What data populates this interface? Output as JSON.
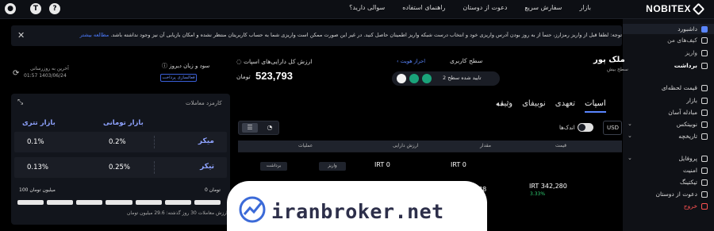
{
  "topbar": {
    "logo": "NOBITEX",
    "nav": [
      "بازار",
      "سفارش سریع",
      "دعوت از دوستان",
      "راهنمای استفاده",
      "سوالی دارید؟"
    ],
    "icons": [
      "user-icon",
      "shirt-icon",
      "help-icon"
    ]
  },
  "notice": {
    "text": "توجه: لطفا قبل از واریز رمزارز، حتماً از به روز بودن آدرس واریزی خود و انتخاب درست شبکه واریز اطمینان حاصل کنید. در غیر این صورت ممکن است واریزی شما به حساب کاربریتان منتظر نشده و امکان بازیابی آن نیز وجود نداشته باشد.",
    "link": "مطالعه بیشتر"
  },
  "sidebar": {
    "items": [
      {
        "label": "داشبورد",
        "active": true,
        "icon": "dashboard-icon"
      },
      {
        "label": "کیف‌های من",
        "icon": "wallet-icon"
      },
      {
        "label": "واریز",
        "icon": "deposit-icon"
      },
      {
        "label": "برداشت",
        "icon": "withdraw-icon",
        "bold": true
      },
      {
        "label": "قیمت لحظه‌ای",
        "icon": "price-icon"
      },
      {
        "label": "بازار",
        "icon": "market-icon"
      },
      {
        "label": "مبادله آسان",
        "icon": "exchange-icon"
      },
      {
        "label": "نوبیتکس",
        "icon": "nobitex-icon"
      },
      {
        "label": "تاریخچه",
        "icon": "history-icon"
      },
      {
        "label": "پروفایل",
        "icon": "profile-icon"
      },
      {
        "label": "امنیت",
        "icon": "security-icon"
      },
      {
        "label": "تیکتینگ",
        "icon": "ticket-icon"
      },
      {
        "label": "دعوت از دوستان",
        "icon": "invite-icon"
      },
      {
        "label": "خروج",
        "icon": "exit-icon",
        "danger": true
      }
    ]
  },
  "header": {
    "user_name": "ملک پور",
    "user_sub": "سطح بیش",
    "level_label": "سطح کاربری",
    "level_link": "احراز هویت",
    "level_status": "تایید شده سطح 2",
    "asset_label": "ارزش کل دارایی‌های اسپات",
    "asset_value": "523,793",
    "asset_unit": "تومان",
    "pl_label": "سود و زیان دیروز",
    "pl_button": "فعالسازی پرداخت",
    "update_label": "آخرین به روزرسانی",
    "update_time": "01:57 1403/06/24"
  },
  "fees": {
    "title": "کارمزد معاملات",
    "col_toman": "بازار تومانی",
    "col_tether": "بازار تتری",
    "rows": [
      {
        "label": "میکر",
        "toman": "0.2%",
        "tether": "0.1%"
      },
      {
        "label": "تیکر",
        "toman": "0.25%",
        "tether": "0.13%"
      }
    ],
    "progress_left": "100 میلیون تومان",
    "progress_right": "0 تومان",
    "progress_fraction": 1.0,
    "footer": "ارزش معاملات 30 روز گذشته: 29.6 میلیون تومان"
  },
  "tabs": [
    "اسپات",
    "تعهدی",
    "نوبیفای",
    "وثیقه"
  ],
  "table": {
    "small_assets": "اندک‌ها",
    "currency": "USD",
    "headers": [
      "قیمت",
      "مقدار",
      "ارزش دارایی",
      "عملیات"
    ],
    "rows": [
      {
        "price": "IRT 0",
        "amount": "IRT 0",
        "value": "",
        "deposit": "واریز",
        "withdraw": "برداشت"
      },
      {
        "price": "IRT 342,280",
        "change": "3.33%",
        "amount": "338"
      }
    ]
  },
  "watermark": "iranbroker.net"
}
